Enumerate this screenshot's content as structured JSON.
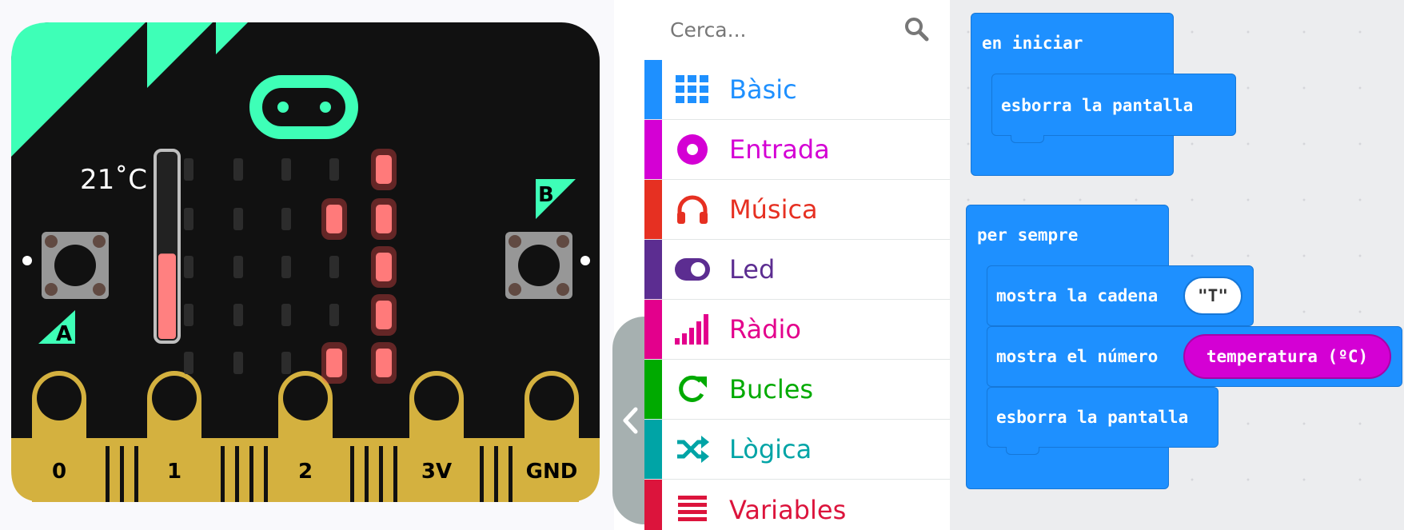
{
  "simulator": {
    "temperature_label": "21˚C",
    "temperature_level": 0.46,
    "button_a_label": "A",
    "button_b_label": "B",
    "pins": [
      "0",
      "1",
      "2",
      "3V",
      "GND"
    ],
    "led_matrix": [
      [
        0,
        0,
        0,
        0,
        1
      ],
      [
        0,
        0,
        0,
        1,
        1
      ],
      [
        0,
        0,
        0,
        0,
        1
      ],
      [
        0,
        0,
        0,
        0,
        1
      ],
      [
        0,
        0,
        0,
        1,
        1
      ]
    ],
    "colors": {
      "board": "#111111",
      "accent": "#3effb7",
      "pin_gold": "#d4b13f",
      "led_on": "#ff6b6b"
    }
  },
  "toolbox": {
    "search_placeholder": "Cerca...",
    "categories": [
      {
        "label": "Bàsic",
        "color": "#1e90ff",
        "icon": "grid-icon"
      },
      {
        "label": "Entrada",
        "color": "#d400d4",
        "icon": "circle-dot-icon"
      },
      {
        "label": "Música",
        "color": "#e63022",
        "icon": "headphones-icon"
      },
      {
        "label": "Led",
        "color": "#5c2d91",
        "icon": "toggle-icon"
      },
      {
        "label": "Ràdio",
        "color": "#e3008c",
        "icon": "signal-bars-icon"
      },
      {
        "label": "Bucles",
        "color": "#00aa00",
        "icon": "refresh-icon"
      },
      {
        "label": "Lògica",
        "color": "#00a4a6",
        "icon": "shuffle-icon"
      },
      {
        "label": "Variables",
        "color": "#dc143c",
        "icon": "list-icon"
      }
    ]
  },
  "workspace": {
    "on_start": {
      "hat": "en iniciar",
      "statements": [
        "esborra la pantalla"
      ]
    },
    "forever": {
      "hat": "per sempre",
      "show_string": "mostra la cadena",
      "string_value": "\"T\"",
      "show_number": "mostra el número",
      "number_reporter": "temperatura (ºC)",
      "clear_screen": "esborra la pantalla"
    },
    "colors": {
      "basic": "#1e90ff",
      "input": "#d400d4"
    }
  }
}
